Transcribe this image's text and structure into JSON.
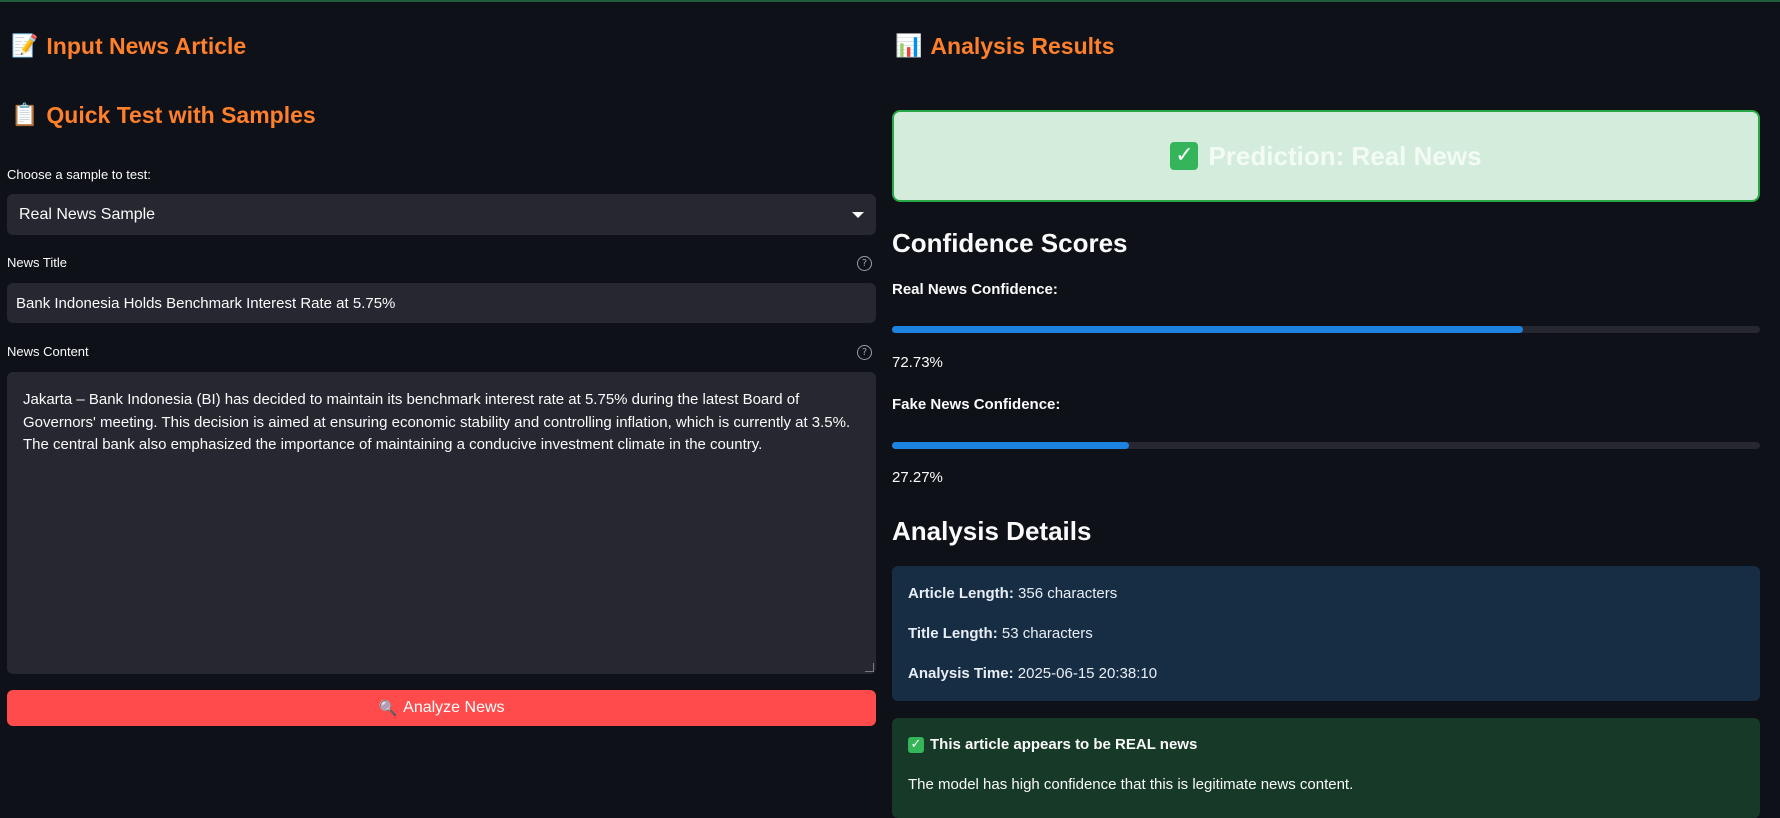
{
  "left": {
    "input_heading": "Input News Article",
    "input_heading_icon": "📝",
    "samples_heading": "Quick Test with Samples",
    "samples_heading_icon": "📋",
    "sample_select_label": "Choose a sample to test:",
    "sample_select_value": "Real News Sample",
    "title_label": "News Title",
    "title_value": "Bank Indonesia Holds Benchmark Interest Rate at 5.75%",
    "content_label": "News Content",
    "content_value": "Jakarta – Bank Indonesia (BI) has decided to maintain its benchmark interest rate at 5.75% during the latest Board of Governors' meeting. This decision is aimed at ensuring economic stability and controlling inflation, which is currently at 3.5%. The central bank also emphasized the importance of maintaining a conducive investment climate in the country.",
    "analyze_button_icon": "🔍",
    "analyze_button_label": "Analyze News",
    "help_glyph": "?"
  },
  "right": {
    "results_heading": "Analysis Results",
    "results_heading_icon": "📊",
    "prediction_icon": "✓",
    "prediction_text": "Prediction: Real News",
    "confidence_heading": "Confidence Scores",
    "real_label": "Real News Confidence:",
    "real_value_text": "72.73%",
    "real_fraction": 0.7273,
    "fake_label": "Fake News Confidence:",
    "fake_value_text": "27.27%",
    "fake_fraction": 0.2727,
    "details_heading": "Analysis Details",
    "article_length_label": "Article Length:",
    "article_length_value": "356 characters",
    "title_length_label": "Title Length:",
    "title_length_value": "53 characters",
    "analysis_time_label": "Analysis Time:",
    "analysis_time_value": "2025-06-15 20:38:10",
    "verdict_icon": "✓",
    "verdict_title": "This article appears to be REAL news",
    "verdict_text": "The model has high confidence that this is legitimate news content."
  },
  "colors": {
    "accent_orange": "#ff7f2a",
    "button_red": "#ff4b4b",
    "progress_blue": "#1c83e1",
    "success_green": "#28a745"
  }
}
